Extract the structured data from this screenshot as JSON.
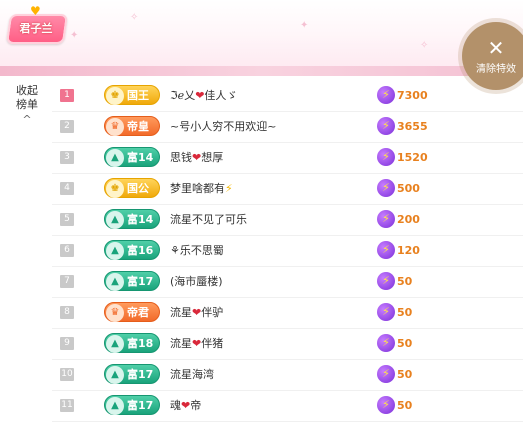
{
  "header": {
    "title_badge": "君子兰",
    "clear_button_label": "清除特效",
    "clear_button_icon": "close-icon"
  },
  "sidebar": {
    "collapse_label_line1": "收起",
    "collapse_label_line2": "榜单",
    "collapse_icon": "^"
  },
  "colors": {
    "accent_pink": "#f0738f",
    "score_orange": "#e8811f",
    "gold_badge": "#f0a90b",
    "orange_badge": "#f26a2a",
    "green_badge": "#19a37b",
    "clear_button": "#b3916a"
  },
  "rows": [
    {
      "rank": "1",
      "badge_type": "gold",
      "badge_icon": "♚",
      "badge_text": "国王",
      "name_pre": "ℑℯ乂",
      "heart": "❤",
      "name_post": "佳人ゞ",
      "score": "7300"
    },
    {
      "rank": "2",
      "badge_type": "orange",
      "badge_icon": "♛",
      "badge_text": "帝皇",
      "name_pre": "~号小人穷不用欢迎~",
      "heart": "",
      "name_post": "",
      "score": "3655"
    },
    {
      "rank": "3",
      "badge_type": "green",
      "badge_icon": "▲",
      "badge_text": "富14",
      "name_pre": "思钱",
      "heart": "❤",
      "name_post": "想厚",
      "score": "1520"
    },
    {
      "rank": "4",
      "badge_type": "gold",
      "badge_icon": "♚",
      "badge_text": "国公",
      "name_pre": "梦里啥都有",
      "heart": "⚡",
      "name_post": "",
      "score": "500"
    },
    {
      "rank": "5",
      "badge_type": "green",
      "badge_icon": "▲",
      "badge_text": "富14",
      "name_pre": "流星不见了可乐",
      "heart": "",
      "name_post": "",
      "score": "200"
    },
    {
      "rank": "6",
      "badge_type": "green",
      "badge_icon": "▲",
      "badge_text": "富16",
      "name_pre": "⚘",
      "heart": "",
      "name_post": "乐不思蜀",
      "score": "120"
    },
    {
      "rank": "7",
      "badge_type": "green",
      "badge_icon": "▲",
      "badge_text": "富17",
      "name_pre": "(海市蜃楼)",
      "heart": "",
      "name_post": "",
      "score": "50"
    },
    {
      "rank": "8",
      "badge_type": "orange",
      "badge_icon": "♛",
      "badge_text": "帝君",
      "name_pre": "流星",
      "heart": "❤",
      "name_post": "伴驴",
      "score": "50"
    },
    {
      "rank": "9",
      "badge_type": "green",
      "badge_icon": "▲",
      "badge_text": "富18",
      "name_pre": "流星",
      "heart": "❤",
      "name_post": "伴猪",
      "score": "50"
    },
    {
      "rank": "10",
      "badge_type": "green",
      "badge_icon": "▲",
      "badge_text": "富17",
      "name_pre": "流星海湾",
      "heart": "",
      "name_post": "",
      "score": "50"
    },
    {
      "rank": "11",
      "badge_type": "green",
      "badge_icon": "▲",
      "badge_text": "富17",
      "name_pre": "魂",
      "heart": "❤",
      "name_post": "帝",
      "score": "50"
    }
  ]
}
